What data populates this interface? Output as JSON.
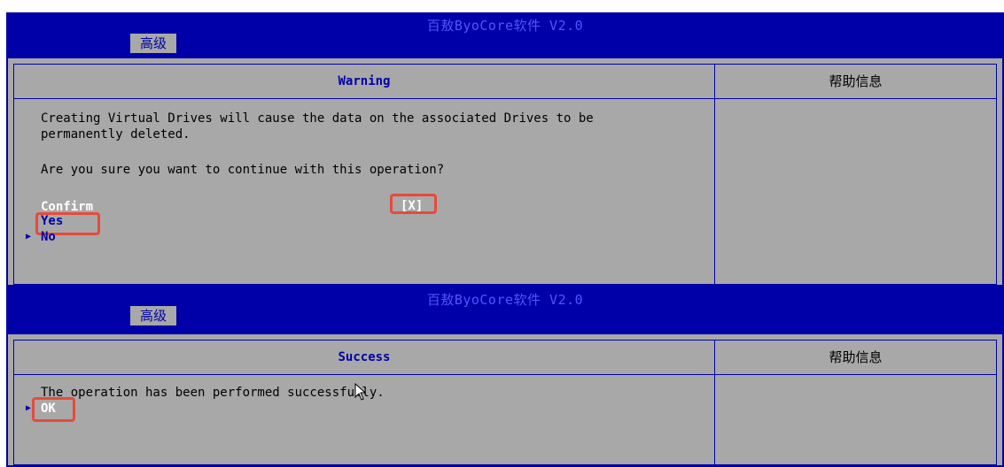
{
  "screen1": {
    "title": "百敖ByoCore软件 V2.0",
    "tab": "高级",
    "dialog_title": "Warning",
    "help_title": "帮助信息",
    "message_line1": "Creating Virtual Drives will cause the data on the associated Drives to be",
    "message_line2": "permanently deleted.",
    "question": "Are you sure you want to continue with this operation?",
    "confirm_label": "Confirm",
    "confirm_value": "[X]",
    "yes_label": "Yes",
    "no_label": "No"
  },
  "screen2": {
    "title": "百敖ByoCore软件 V2.0",
    "tab": "高级",
    "dialog_title": "Success",
    "help_title": "帮助信息",
    "message": "The operation has been performed successfully.",
    "ok_label": "OK"
  },
  "colors": {
    "bios_blue": "#0000a8",
    "panel_gray": "#a8a8a8",
    "highlight_red": "#e84a3a"
  },
  "icons": [
    "selection-arrow-icon",
    "mouse-cursor-icon"
  ]
}
